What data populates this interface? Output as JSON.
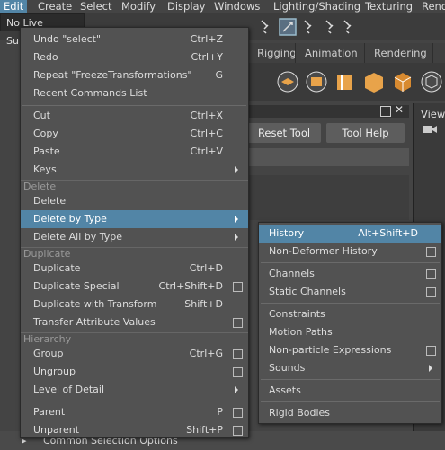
{
  "menubar": {
    "items": [
      "Edit",
      "Create",
      "Select",
      "Modify",
      "Display",
      "Windows",
      "Lighting/Shading",
      "Texturing",
      "Rend"
    ]
  },
  "toolbar": {
    "live_surface": "No Live Surface"
  },
  "shelf": {
    "tabs": [
      "Rigging",
      "Animation",
      "Rendering"
    ]
  },
  "tool_panel": {
    "reset_label": "Reset Tool",
    "help_label": "Tool Help"
  },
  "view_panel": {
    "title": "View"
  },
  "bottom": {
    "label": "Common Selection Options"
  },
  "edit_menu": {
    "items": [
      {
        "label": "Undo \"select\"",
        "shortcut": "Ctrl+Z"
      },
      {
        "label": "Redo",
        "shortcut": "Ctrl+Y"
      },
      {
        "label": "Repeat \"FreezeTransformations\"",
        "shortcut": "G"
      },
      {
        "label": "Recent Commands List",
        "shortcut": ""
      },
      {
        "label": "Cut",
        "shortcut": "Ctrl+X"
      },
      {
        "label": "Copy",
        "shortcut": "Ctrl+C"
      },
      {
        "label": "Paste",
        "shortcut": "Ctrl+V"
      },
      {
        "label": "Keys",
        "shortcut": ""
      },
      {
        "label": "Delete",
        "shortcut": ""
      },
      {
        "label": "Delete by Type",
        "shortcut": ""
      },
      {
        "label": "Delete All by Type",
        "shortcut": ""
      },
      {
        "label": "Duplicate",
        "shortcut": "Ctrl+D"
      },
      {
        "label": "Duplicate Special",
        "shortcut": "Ctrl+Shift+D"
      },
      {
        "label": "Duplicate with Transform",
        "shortcut": "Shift+D"
      },
      {
        "label": "Transfer Attribute Values",
        "shortcut": ""
      },
      {
        "label": "Group",
        "shortcut": "Ctrl+G"
      },
      {
        "label": "Ungroup",
        "shortcut": ""
      },
      {
        "label": "Level of Detail",
        "shortcut": ""
      },
      {
        "label": "Parent",
        "shortcut": "P"
      },
      {
        "label": "Unparent",
        "shortcut": "Shift+P"
      }
    ],
    "sections": [
      "Delete",
      "Duplicate",
      "Hierarchy"
    ]
  },
  "delete_by_type_menu": {
    "items": [
      {
        "label": "History",
        "shortcut": "Alt+Shift+D"
      },
      {
        "label": "Non-Deformer History",
        "shortcut": ""
      },
      {
        "label": "Channels",
        "shortcut": ""
      },
      {
        "label": "Static Channels",
        "shortcut": ""
      },
      {
        "label": "Constraints",
        "shortcut": ""
      },
      {
        "label": "Motion Paths",
        "shortcut": ""
      },
      {
        "label": "Non-particle Expressions",
        "shortcut": ""
      },
      {
        "label": "Sounds",
        "shortcut": ""
      },
      {
        "label": "Assets",
        "shortcut": ""
      },
      {
        "label": "Rigid Bodies",
        "shortcut": ""
      }
    ]
  },
  "colors": {
    "highlight": "#5285a6",
    "menu_bg": "#525252",
    "app_bg": "#444444"
  }
}
